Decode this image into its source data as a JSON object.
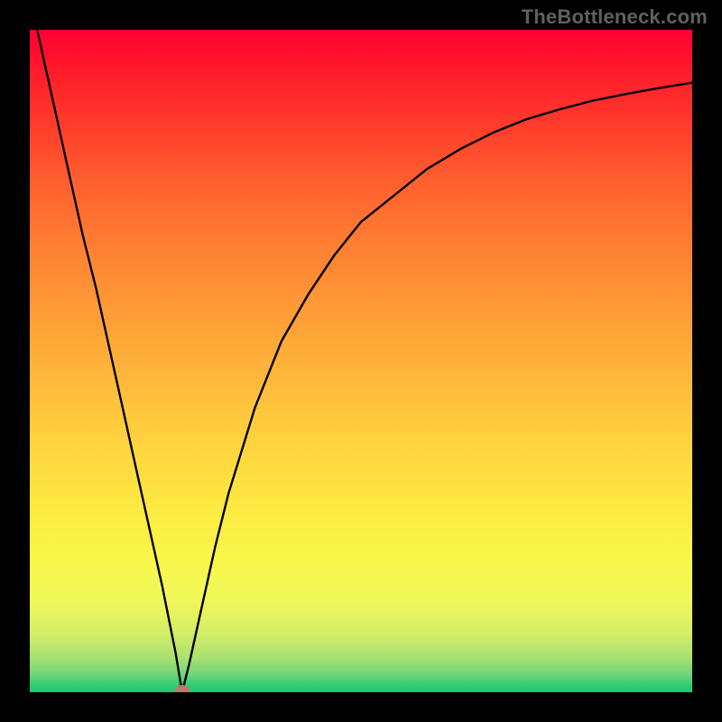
{
  "header": {
    "wordmark": "TheBottleneck.com"
  },
  "colors": {
    "frame": "#000000",
    "gradient_top": "#ff0033",
    "gradient_bottom": "#1fc86d",
    "valley_dot": "#c27664",
    "curve": "#000000"
  },
  "chart_data": {
    "type": "line",
    "title": "",
    "xlabel": "",
    "ylabel": "",
    "ylim": [
      0,
      100
    ],
    "xlim": [
      0,
      100
    ],
    "valley_x": 23,
    "x": [
      0,
      2,
      4,
      6,
      8,
      10,
      12,
      14,
      16,
      18,
      20,
      22,
      23,
      24,
      26,
      28,
      30,
      34,
      38,
      42,
      46,
      50,
      55,
      60,
      65,
      70,
      75,
      80,
      85,
      90,
      95,
      100
    ],
    "values": [
      105,
      96,
      87,
      78,
      69,
      61,
      52,
      43,
      34,
      25,
      16,
      6,
      0,
      4,
      13,
      22,
      30,
      43,
      53,
      60,
      66,
      71,
      75,
      79,
      82,
      84.5,
      86.5,
      88,
      89.3,
      90.3,
      91.2,
      92
    ]
  }
}
